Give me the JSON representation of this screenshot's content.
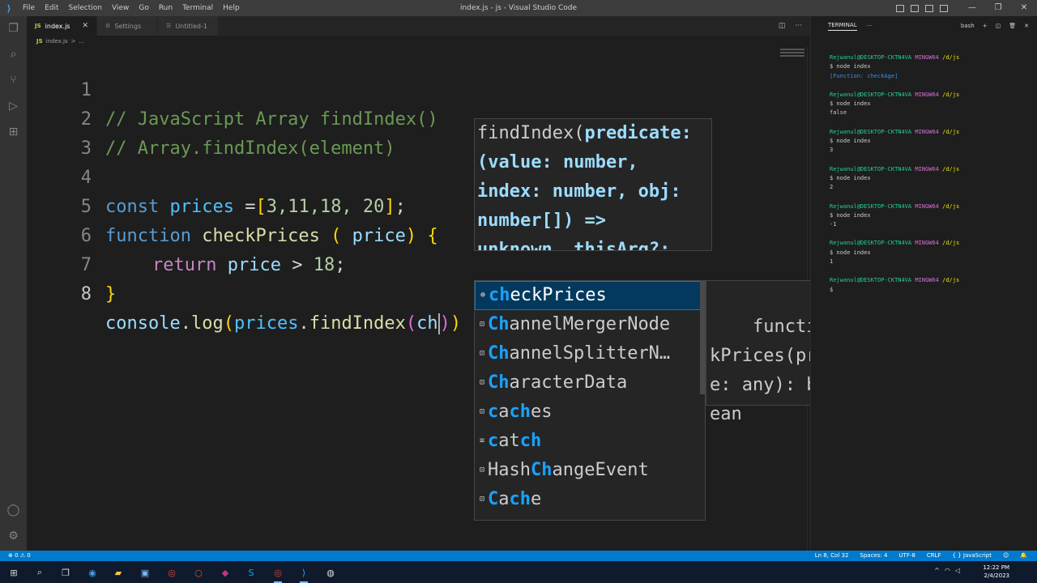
{
  "window": {
    "title": "index.js - js - Visual Studio Code",
    "menu": [
      "File",
      "Edit",
      "Selection",
      "View",
      "Go",
      "Run",
      "Terminal",
      "Help"
    ]
  },
  "tabs": [
    {
      "label": "index.js",
      "icon": "js-file-icon",
      "active": true
    },
    {
      "label": "Settings",
      "icon": "gear-icon",
      "active": false
    },
    {
      "label": "Untitled-1",
      "icon": "file-icon",
      "active": false
    }
  ],
  "breadcrumb": {
    "file": "index.js",
    "sep": ">",
    "rest": "..."
  },
  "editor": {
    "line_numbers": [
      "1",
      "2",
      "3",
      "4",
      "5",
      "6",
      "7",
      "8"
    ],
    "lines": {
      "l1": "// JavaScript Array findIndex()",
      "l2": "// Array.findIndex(element)",
      "l4_kw": "const",
      "l4_var": "prices",
      "l4_eq": " =",
      "l4_open": "[",
      "l4_vals": "3,11,18, 20",
      "l4_close": "]",
      "l4_semi": ";",
      "l5_kw": "function",
      "l5_fn": "checkPrices",
      "l5_open": " ( ",
      "l5_param": "price",
      "l5_close": ") ",
      "l5_brace": "{",
      "l6_kw": "return",
      "l6_var": "price",
      "l6_op": " > ",
      "l6_num": "18",
      "l6_semi": ";",
      "l7_brace": "}",
      "l8_console": "console",
      "l8_dot1": ".",
      "l8_log": "log",
      "l8_open1": "(",
      "l8_prices": "prices",
      "l8_dot2": ".",
      "l8_find": "findIndex",
      "l8_open2": "(",
      "l8_typed": "ch",
      "l8_close2": ")",
      "l8_close1": ")"
    }
  },
  "param_hint": {
    "name": "findIndex(",
    "param": "predicate:",
    "line2": "(value: number,",
    "line3": "index: number, obj:",
    "line4": "number[]) =>",
    "line5": "unknown, thisArg?:"
  },
  "suggest": {
    "items": [
      {
        "match": "ch",
        "rest": "eckPrices",
        "icon": "function-icon",
        "selected": true
      },
      {
        "pre": "",
        "match": "Ch",
        "rest": "annelMergerNode",
        "icon": "variable-icon"
      },
      {
        "pre": "",
        "match": "Ch",
        "rest": "annelSplitterN…",
        "icon": "variable-icon"
      },
      {
        "pre": "",
        "match": "Ch",
        "rest": "aracterData",
        "icon": "variable-icon"
      },
      {
        "pre": "",
        "match": "c",
        "mid": "a",
        "match2": "ch",
        "rest": "es",
        "icon": "variable-icon"
      },
      {
        "pre": "",
        "match": "c",
        "mid": "at",
        "match2": "ch",
        "rest": "",
        "icon": "keyword-icon"
      },
      {
        "pre": "Hash",
        "match": "Ch",
        "rest": "angeEvent",
        "icon": "variable-icon"
      },
      {
        "pre": "",
        "match": "C",
        "mid": "a",
        "match2": "ch",
        "rest": "e",
        "icon": "variable-icon"
      }
    ],
    "detail": "function chec\nkPrices(pric\ne: any): bool\nean",
    "detail_close": "×"
  },
  "terminal": {
    "title": "TERMINAL",
    "more": "···",
    "shell": "bash",
    "add": "+",
    "blocks": [
      {
        "user": "Rejwanul@DESKTOP-CKTN4VA",
        "host": "MINGW64",
        "path": "/d/js",
        "cmd": "$ node index",
        "out": "[Function: checkAge]",
        "out_fn": true
      },
      {
        "user": "Rejwanul@DESKTOP-CKTN4VA",
        "host": "MINGW64",
        "path": "/d/js",
        "cmd": "$ node index",
        "out": "false",
        "out_fn": false
      },
      {
        "user": "Rejwanul@DESKTOP-CKTN4VA",
        "host": "MINGW64",
        "path": "/d/js",
        "cmd": "$ node index",
        "out": "3",
        "out_fn": false
      },
      {
        "user": "Rejwanul@DESKTOP-CKTN4VA",
        "host": "MINGW64",
        "path": "/d/js",
        "cmd": "$ node index",
        "out": "2",
        "out_fn": false
      },
      {
        "user": "Rejwanul@DESKTOP-CKTN4VA",
        "host": "MINGW64",
        "path": "/d/js",
        "cmd": "$ node index",
        "out": "-1",
        "out_fn": false
      },
      {
        "user": "Rejwanul@DESKTOP-CKTN4VA",
        "host": "MINGW64",
        "path": "/d/js",
        "cmd": "$ node index",
        "out": "1",
        "out_fn": false
      },
      {
        "user": "Rejwanul@DESKTOP-CKTN4VA",
        "host": "MINGW64",
        "path": "/d/js",
        "cmd": "$",
        "out": "",
        "out_fn": false
      }
    ]
  },
  "statusbar": {
    "problems": "⊗ 0 ⚠ 0",
    "position": "Ln 8, Col 32",
    "spaces": "Spaces: 4",
    "encoding": "UTF-8",
    "eol": "CRLF",
    "language": "{ } JavaScript"
  },
  "taskbar": {
    "time": "12:22 PM",
    "date": "2/4/2023"
  },
  "colors": {
    "accent": "#007acc",
    "titlebar": "#3c3c3c",
    "editor_bg": "#1e1e1e"
  }
}
